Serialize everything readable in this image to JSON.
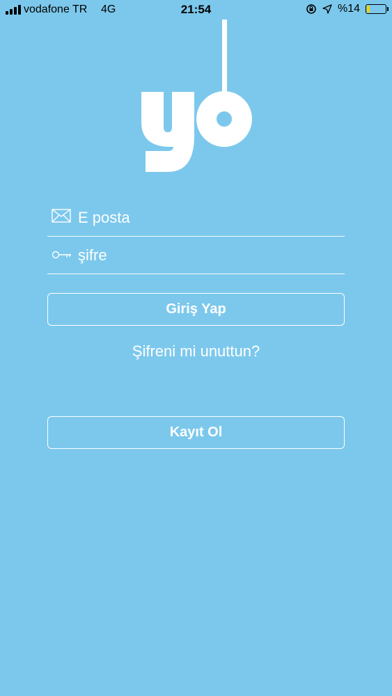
{
  "status_bar": {
    "carrier": "vodafone TR",
    "network": "4G",
    "time": "21:54",
    "battery": "%14",
    "battery_level": 0.14
  },
  "login": {
    "email_placeholder": "E posta",
    "password_placeholder": "şifre",
    "login_button": "Giriş Yap",
    "forgot_password": "Şifreni mi unuttun?",
    "register_button": "Kayıt Ol"
  },
  "colors": {
    "background": "#7CC8EC",
    "foreground": "#FFFFFF",
    "battery_fill": "#F5D300"
  },
  "icons": {
    "email": "envelope-icon",
    "password": "key-icon"
  }
}
